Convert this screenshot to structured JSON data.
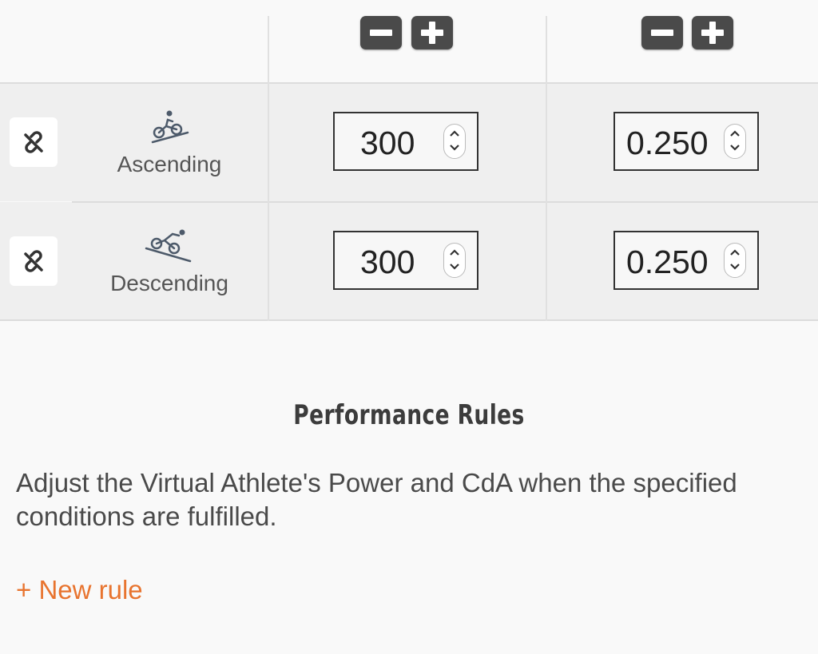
{
  "table": {
    "columns": [
      {
        "minus_icon": "minus-icon",
        "plus_icon": "plus-icon"
      },
      {
        "minus_icon": "minus-icon",
        "plus_icon": "plus-icon"
      }
    ],
    "rows": [
      {
        "condition": "Ascending",
        "icon": "cyclist-ascending-icon",
        "link_icon": "unlink-icon",
        "power": "300",
        "cda": "0.250"
      },
      {
        "condition": "Descending",
        "icon": "cyclist-descending-icon",
        "link_icon": "unlink-icon",
        "power": "300",
        "cda": "0.250"
      }
    ]
  },
  "section": {
    "title": "Performance Rules",
    "description": "Adjust the Virtual Athlete's Power and CdA when the specified conditions are fulfilled.",
    "new_rule_label": "+ New rule"
  },
  "colors": {
    "accent": "#e8742f",
    "button_dark": "#4a4a4a",
    "row_background": "#efefef"
  }
}
